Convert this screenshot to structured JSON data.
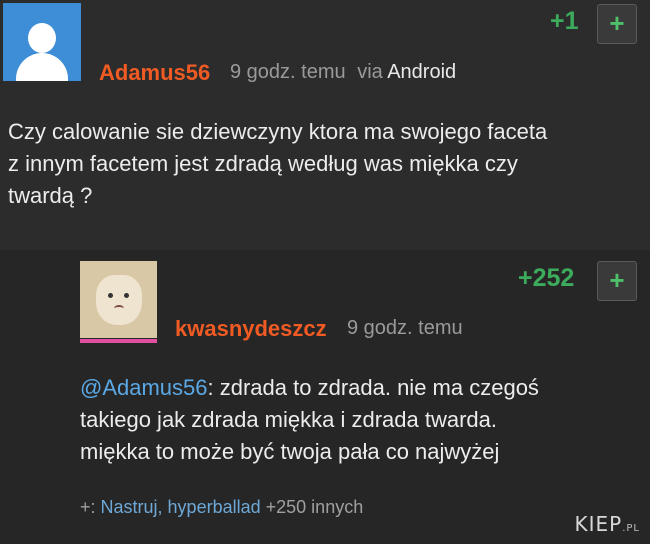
{
  "post": {
    "author": "Adamus56",
    "time": "9 godz. temu",
    "via": "via",
    "source": "Android",
    "votes": "+1",
    "plus": "+",
    "lines": [
      "Czy calowanie sie dziewczyny ktora ma swojego faceta",
      "z innym facetem jest zdradą według was miękka czy",
      "twardą ?"
    ]
  },
  "reply": {
    "author": "kwasnydeszcz",
    "time": "9 godz. temu",
    "votes": "+252",
    "plus": "+",
    "mention": "@Adamus56",
    "line1_rest": ": zdrada to zdrada. nie ma czegoś",
    "line2": "takiego jak zdrada miękka i zdrada twarda.",
    "line3": "miękka to może być twoja pała co najwyżej",
    "footer_prefix": "+:",
    "footer_names": "Nastruj, hyperballad",
    "footer_more": "+250 innych"
  },
  "watermark": {
    "main": "KIEP",
    "suffix": ".PL"
  },
  "colors": {
    "author": "#f05a23",
    "vote": "#3cab5c",
    "mention": "#5aa9e6",
    "background": "#2b2b2b"
  }
}
